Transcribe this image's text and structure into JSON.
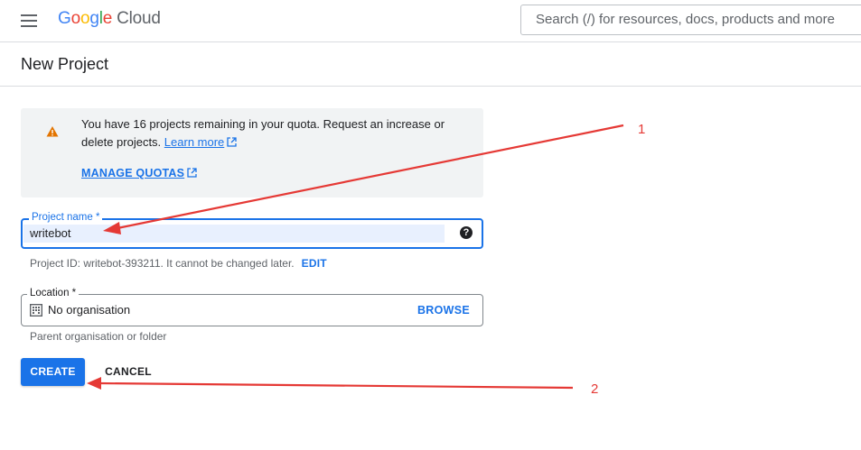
{
  "header": {
    "logo": {
      "google": "Google",
      "cloud": "Cloud"
    },
    "search": {
      "placeholder": "Search (/) for resources, docs, products and more"
    }
  },
  "page": {
    "title": "New Project"
  },
  "quota": {
    "message": "You have 16 projects remaining in your quota. Request an increase or delete projects.",
    "learn_more": "Learn more",
    "manage_quotas": "MANAGE QUOTAS"
  },
  "form": {
    "project_name": {
      "label": "Project name *",
      "value": "writebot"
    },
    "project_id_hint": "Project ID: writebot-393211. It cannot be changed later.",
    "edit_label": "EDIT",
    "location": {
      "label": "Location *",
      "value": "No organisation",
      "browse_label": "BROWSE"
    },
    "location_hint": "Parent organisation or folder",
    "create_label": "CREATE",
    "cancel_label": "CANCEL"
  },
  "annotations": [
    {
      "label": "1",
      "color": "#e53935"
    },
    {
      "label": "2",
      "color": "#e53935"
    }
  ],
  "icons": [
    "menu-icon",
    "warning-icon",
    "external-link-icon",
    "help-icon",
    "organisation-icon"
  ],
  "colors": {
    "accent": "#1a73e8",
    "warning": "#e37400",
    "annotation": "#e53935"
  }
}
